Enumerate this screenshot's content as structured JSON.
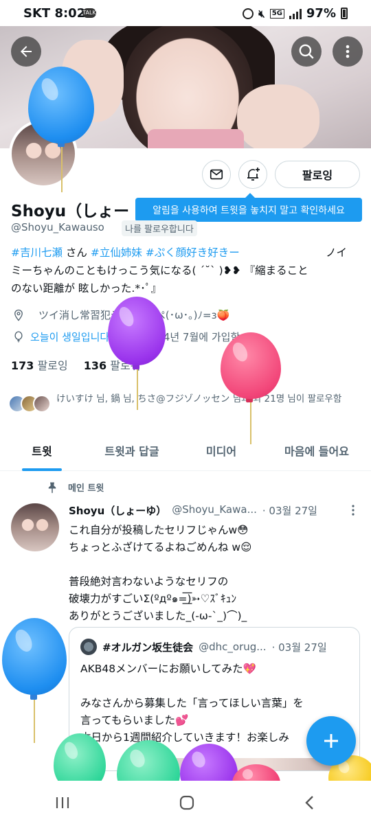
{
  "status_bar": {
    "carrier_time": "SKT 8:02",
    "talk_badge": "TALK",
    "network": "5G",
    "battery": "97%"
  },
  "profile": {
    "display_name": "Shoyu（しょー",
    "handle": "@Shoyu_Kawauso",
    "follows_you": "나를 팔로우합니다",
    "follow_button": "팔로잉",
    "notify_tooltip": "알림을 사용하여 트윗을 놓치지 말고 확인하세요",
    "bio": {
      "tag1": "#吉川七瀬",
      "san": " さん ",
      "tag2": "#立仙姉妹",
      "tag3": "#ぷく顔好き好きー",
      "rest1": "ノイ",
      "rest2": "ミーちゃんのこともけっこう気になる( ´˘` )❥❥ 『縮まること",
      "rest3": "のない距離が 眩しかった.*･ﾟ』"
    },
    "location": "ツイ消し常習犯デス ぺっぺ(･ω･｡)ﾉ=з🍑",
    "birthday": "오늘이 생일입니다!",
    "joined": "2014년 7월에 가입함",
    "following_count": "173",
    "following_label": "팔로잉",
    "followers_count": "136",
    "followers_label": "팔로워",
    "mutual_text": "けいすけ 님, 鍋 님, ちさ@フジゾノッセン 님과 외 21명 님이 팔로우함"
  },
  "tabs": [
    {
      "label": "트윗"
    },
    {
      "label": "트윗과 답글"
    },
    {
      "label": "미디어"
    },
    {
      "label": "마음에 들어요"
    }
  ],
  "pinned_label": "메인 트윗",
  "tweet": {
    "name": "Shoyu（しょーゆ）",
    "handle": "@Shoyu_Kawa...",
    "date": "· 03월 27일",
    "body": "これ自分が投稿したセリフじゃんw😳\nちょっとふざけてるよねごめんね w😌\n\n普段絶対言わないようなセリフの\n破壊力がすごいΣ(ºдº๑=͟͟͞͞)➳♡ｽﾞｷｭﾝ\nありがとうございました_(-ω-`_)⌒)_",
    "quote": {
      "name": "#オルガン坂生徒会",
      "handle": "@dhc_orug...",
      "date": "· 03월 27일",
      "body": "AKB48メンバーにお願いしてみた💖\n\nみなさんから募集した「言ってほしい言葉」を\n言ってもらいました💕\n本日から1週間紹介していきます！お楽しみ"
    }
  },
  "colors": {
    "accent": "#1d9bf0",
    "text": "#0f1419",
    "muted": "#536471"
  },
  "icons": [
    "back-arrow-icon",
    "search-icon",
    "more-vertical-icon",
    "mail-icon",
    "bell-plus-icon",
    "location-icon",
    "balloon-icon",
    "calendar-icon",
    "pin-icon",
    "compose-plus-icon"
  ]
}
